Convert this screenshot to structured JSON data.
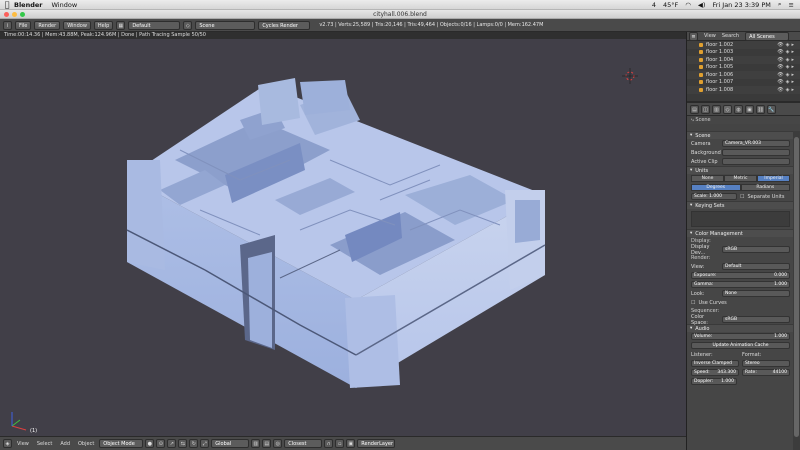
{
  "mac_menu": {
    "app": "Blender",
    "window": "Window",
    "status": {
      "temp": "45°F",
      "datetime": "Fri Jan 23  3:39 PM",
      "badge": "4"
    }
  },
  "window_title": "cityhall.006.blend",
  "info_header": {
    "menus": [
      "File",
      "Render",
      "Window",
      "Help"
    ],
    "layout": "Default",
    "scene": "Scene",
    "engine": "Cycles Render",
    "stats": "v2.73 | Verts:25,589 | Tris:20,146 | Tris:49,464 | Objects:0/16 | Lamps:0/0 | Mem:162.47M"
  },
  "viewport": {
    "status": "Time:00:14.36 | Mem:43.88M, Peak:124.96M | Done | Path Tracing Sample 50/50",
    "axis_label": "(1)"
  },
  "bottom_bar": {
    "menus": [
      "View",
      "Select",
      "Add",
      "Object"
    ],
    "mode": "Object Mode",
    "pivot": "Global",
    "proportional": "Closest",
    "layer": "RenderLayer"
  },
  "outliner": {
    "header": {
      "view": "View",
      "search": "Search",
      "scenes": "All Scenes"
    },
    "items": [
      "floor 1.002",
      "floor 1.003",
      "floor 1.004",
      "floor 1.005",
      "floor 1.006",
      "floor 1.007",
      "floor 1.008"
    ]
  },
  "properties": {
    "context": "Scene",
    "scene_panel": {
      "title": "Scene",
      "camera_label": "Camera",
      "camera_value": "Camera_VR.003",
      "background_label": "Background",
      "active_clip_label": "Active Clip"
    },
    "units_panel": {
      "title": "Units",
      "systems": [
        "None",
        "Metric",
        "Imperial"
      ],
      "rotation": [
        "Degrees",
        "Radians"
      ],
      "scale_label": "Scale:",
      "scale_value": "1.000",
      "separate_units": "Separate Units"
    },
    "keying_panel": {
      "title": "Keying Sets"
    },
    "color_panel": {
      "title": "Color Management",
      "display_label": "Display:",
      "display_device_label": "Display Dev...",
      "display_device_value": "sRGB",
      "render_label": "Render:",
      "view_label": "View:",
      "view_value": "Default",
      "exposure_label": "Exposure:",
      "exposure_value": "0.000",
      "gamma_label": "Gamma:",
      "gamma_value": "1.000",
      "look_label": "Look:",
      "look_value": "None",
      "curves_label": "Use Curves",
      "sequencer_label": "Sequencer:",
      "colorspace_label": "Color Space:",
      "colorspace_value": "sRGB"
    },
    "audio_panel": {
      "title": "Audio",
      "volume_label": "Volume:",
      "volume_value": "1.000",
      "update_button": "Update Animation Cache",
      "listener_label": "Listener:",
      "format_label": "Format:",
      "distance_value": "Inverse Clamped",
      "format_value": "Stereo",
      "speed_label": "Speed:",
      "speed_value": "343.300",
      "rate_label": "Rate:",
      "rate_value": "44100",
      "doppler_label": "Doppler:",
      "doppler_value": "1.000"
    }
  },
  "colors": {
    "model": "#b3c3e8",
    "model_dark": "#8ea1cf",
    "background": "#413f48",
    "accent": "#5680c2"
  }
}
